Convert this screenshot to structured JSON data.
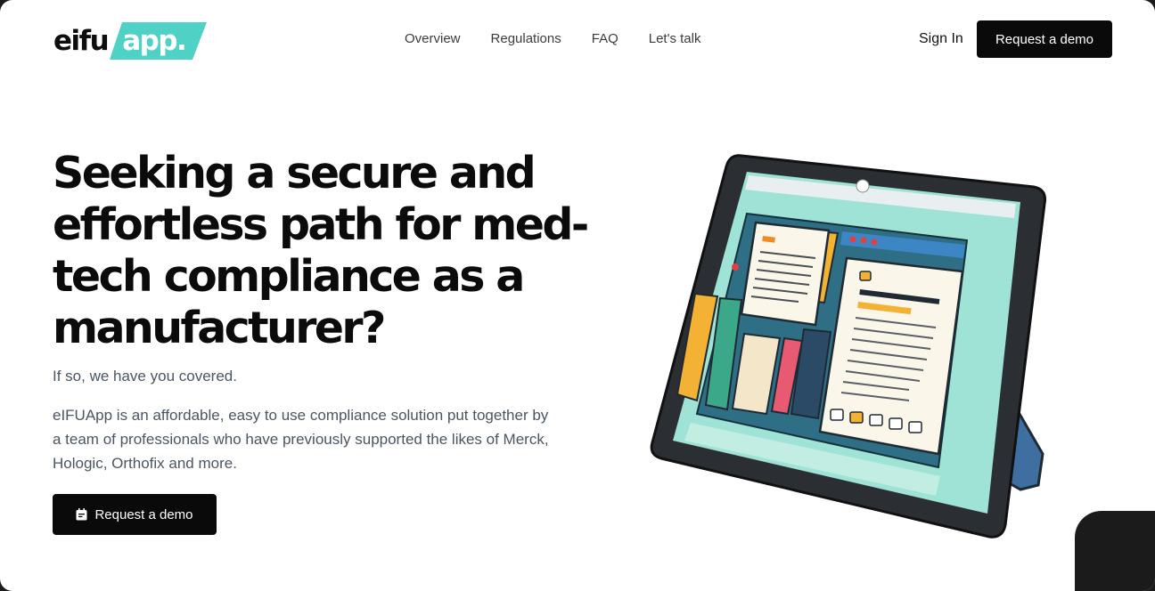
{
  "brand": {
    "logo_left": "eifu",
    "logo_badge": "app.",
    "badge_color": "#4fd1c5"
  },
  "nav": {
    "items": [
      "Overview",
      "Regulations",
      "FAQ",
      "Let's talk"
    ]
  },
  "header": {
    "signin_label": "Sign In",
    "demo_label": "Request a demo"
  },
  "hero": {
    "title": "Seeking a secure and effortless path for med-tech compliance as a manufacturer?",
    "subtitle": "If so, we have you covered.",
    "description": "eIFUApp is an affordable, easy to use compliance solution put together by a team of professionals who have previously supported the likes of Merck, Hologic, Orthofix and more.",
    "cta_label": "Request a demo",
    "cta_icon": "calendar-icon"
  },
  "colors": {
    "accent": "#4fd1c5",
    "button_bg": "#0a0a0a",
    "text_muted": "#4b5563"
  },
  "illustration": {
    "icon": "tablet-documents-illustration"
  }
}
